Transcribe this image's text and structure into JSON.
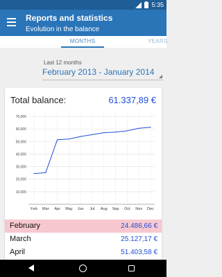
{
  "status_bar": {
    "time": "5:35",
    "icons": [
      "signal-icon",
      "battery-icon"
    ]
  },
  "app_bar": {
    "title": "Reports and statistics",
    "subtitle": "Evolution in the balance",
    "menu_icon": "hamburger-menu-icon"
  },
  "tabs": [
    {
      "label": "MONTHS",
      "selected": true
    },
    {
      "label": "YEARS",
      "selected": false
    }
  ],
  "period": {
    "label": "Last 12 months",
    "value": "February 2013 - January 2014"
  },
  "summary": {
    "label": "Total balance:",
    "value": "61.337,89 €"
  },
  "colors": {
    "primary": "#2a74b8",
    "primary_dark": "#1e5d96",
    "value_blue": "#1f4fd9",
    "highlight_row": "#f7c8cf"
  },
  "chart_data": {
    "type": "line",
    "x": [
      "Feb",
      "Mar",
      "Apr",
      "May",
      "Jun",
      "Jul",
      "Aug",
      "Sep",
      "Oct",
      "Nov",
      "Dec"
    ],
    "y_ticks": [
      "10,000",
      "20,000",
      "30,000",
      "40,000",
      "50,000",
      "60,000",
      "70,000"
    ],
    "ylim": [
      0,
      75000
    ],
    "series": [
      {
        "values": [
          24486.66,
          25127.17,
          51403.58,
          52000,
          54000,
          55500,
          57000,
          57500,
          58500,
          60500,
          61337.89
        ],
        "color": "#1f4fd9"
      }
    ],
    "grid": true,
    "xlabel": "",
    "ylabel": ""
  },
  "rows": [
    {
      "month": "February",
      "value": "24.486,66 €",
      "highlighted": true
    },
    {
      "month": "March",
      "value": "25.127,17 €",
      "highlighted": false
    },
    {
      "month": "April",
      "value": "51.403,58 €",
      "highlighted": false
    }
  ],
  "nav_bar": {
    "icons": [
      "back-icon",
      "home-icon",
      "recent-apps-icon"
    ]
  }
}
